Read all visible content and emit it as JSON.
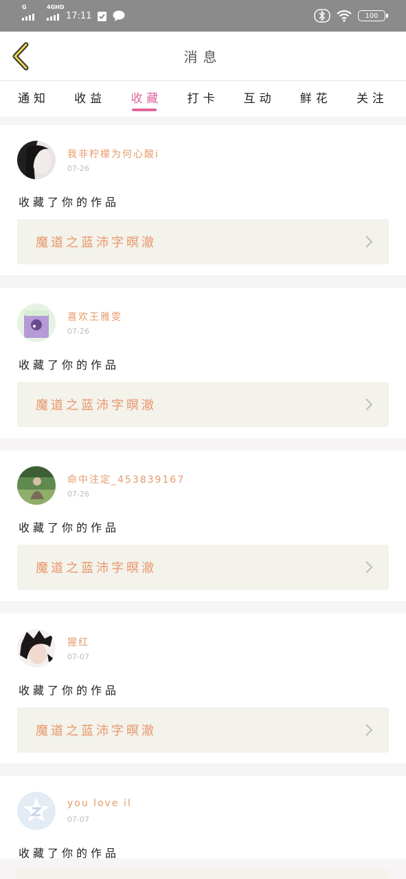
{
  "status_bar": {
    "network_tag_1": "G",
    "network_tag_2": "4GHD",
    "time": "17:11",
    "battery": "100",
    "icons": [
      "signal-icon",
      "signal-4g-icon",
      "check-clipboard-icon",
      "message-bubble-icon",
      "bluetooth-icon",
      "wifi-icon",
      "battery-icon"
    ]
  },
  "header": {
    "title": "消息",
    "back_icon": "chevron-left-icon"
  },
  "tabs": [
    {
      "label": "通知",
      "active": false
    },
    {
      "label": "收益",
      "active": false
    },
    {
      "label": "收藏",
      "active": true
    },
    {
      "label": "打卡",
      "active": false
    },
    {
      "label": "互动",
      "active": false
    },
    {
      "label": "鲜花",
      "active": false
    },
    {
      "label": "关注",
      "active": false
    }
  ],
  "colors": {
    "accent": "#e0649c",
    "username": "#e69a6a",
    "work_title": "#e9956a",
    "work_bg": "#f3f2eb",
    "status_bar": "#8b8b8b"
  },
  "messages": [
    {
      "user": "我非柠檬为何心酸i",
      "date": "07-26",
      "action": "收藏了你的作品",
      "work": "魔道之蓝沛字暝澈"
    },
    {
      "user": "喜欢王雅雯",
      "date": "07-26",
      "action": "收藏了你的作品",
      "work": "魔道之蓝沛字暝澈"
    },
    {
      "user": "命中注定_453839167",
      "date": "07-26",
      "action": "收藏了你的作品",
      "work": "魔道之蓝沛字暝澈"
    },
    {
      "user": "猩红",
      "date": "07-07",
      "action": "收藏了你的作品",
      "work": "魔道之蓝沛字暝澈"
    },
    {
      "user": "you love il",
      "date": "07-07",
      "action": "收藏了你的作品",
      "work": ""
    }
  ]
}
